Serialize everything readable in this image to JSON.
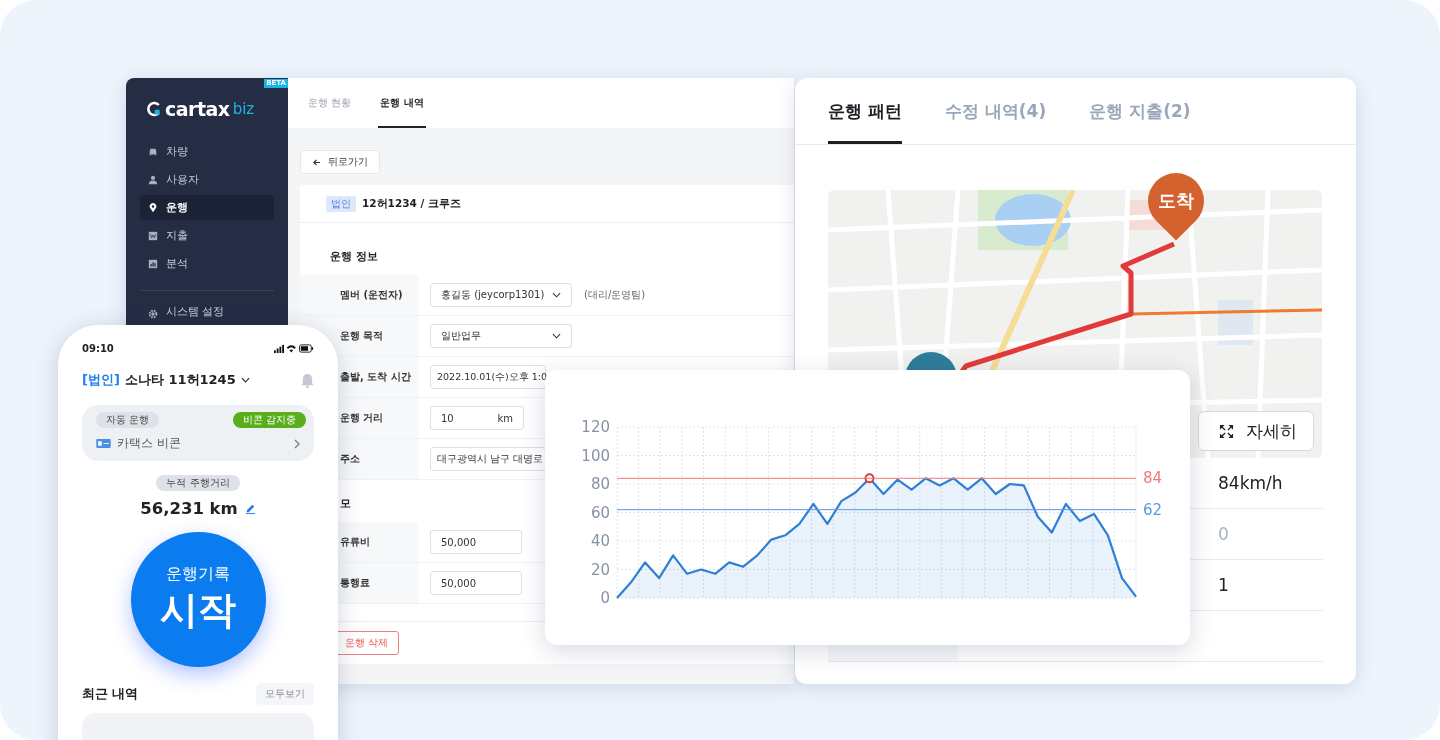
{
  "web_app": {
    "logo": {
      "brand": "cartax",
      "suffix": "biz",
      "badge": "BETA"
    },
    "sidebar": {
      "items": [
        {
          "label": "차량",
          "selected": false
        },
        {
          "label": "사용자",
          "selected": false
        },
        {
          "label": "운행",
          "selected": true
        },
        {
          "label": "지출",
          "selected": false
        },
        {
          "label": "분석",
          "selected": false
        }
      ],
      "settings": "시스템 설정"
    },
    "tabs": [
      {
        "label": "운행 현황",
        "selected": false
      },
      {
        "label": "운행 내역",
        "selected": true
      }
    ],
    "back_button": "뒤로가기",
    "vehicle": {
      "tag": "법인",
      "name": "12허1234 / 크루즈"
    },
    "trip_section": {
      "title": "운행 정보",
      "rows": [
        {
          "label": "멤버 (운전자)",
          "kind": "select",
          "value": "홍길동 (jeycorp1301)",
          "note": "(대리/운영팀)"
        },
        {
          "label": "운행 목적",
          "kind": "select",
          "value": "일반업무"
        },
        {
          "label": "출발, 도착 시간",
          "kind": "input",
          "value": "2022.10.01(수)오후 1:0"
        },
        {
          "label": "운행 거리",
          "kind": "unit",
          "value": "10",
          "unit": "km"
        },
        {
          "label": "주소",
          "kind": "input",
          "value": "대구광역시 남구 대명로"
        }
      ]
    },
    "memo_section": {
      "title": "모",
      "rows": [
        {
          "label": "유류비",
          "value": "50,000"
        },
        {
          "label": "통행료",
          "value": "50,000"
        }
      ]
    },
    "delete_button": "운행 삭제"
  },
  "detail_panel": {
    "tabs": [
      {
        "label": "운행 패턴",
        "selected": true
      },
      {
        "label": "수정 내역(4)",
        "selected": false
      },
      {
        "label": "운행 지출(2)",
        "selected": false
      }
    ],
    "map": {
      "kind": "picture",
      "arrival_pin": "도착",
      "detail_button": "자세히"
    },
    "stats": [
      {
        "value": "84km/h",
        "muted": false
      },
      {
        "value": "0",
        "muted": true
      },
      {
        "value": "1",
        "muted": false
      }
    ]
  },
  "speed_chart": {
    "chart_data": {
      "type": "area",
      "ylim": [
        0,
        120
      ],
      "yticks": [
        0,
        20,
        40,
        60,
        80,
        100,
        120
      ],
      "categories": [
        null,
        null,
        null,
        null,
        null,
        null,
        null,
        null,
        null,
        null,
        null,
        null,
        null,
        null,
        null,
        null,
        null,
        null,
        null,
        null,
        null,
        null,
        null,
        null,
        null,
        null,
        null,
        null,
        null,
        null,
        null,
        null,
        null,
        null,
        null,
        null,
        null,
        null
      ],
      "series": [
        {
          "color": "#2f7fd4",
          "values": [
            0,
            11,
            25,
            14,
            30,
            17,
            20,
            17,
            25,
            22,
            30,
            41,
            44,
            52,
            66,
            52,
            68,
            74,
            84,
            73,
            83,
            76,
            84,
            79,
            84,
            76,
            84,
            73,
            80,
            79,
            57,
            46,
            66,
            54,
            59,
            44,
            14,
            1
          ]
        }
      ],
      "grid": true,
      "ref_lines": [
        {
          "axis": "y",
          "value": 84,
          "label": "84",
          "color": "#f07a7a"
        },
        {
          "axis": "y",
          "value": 62,
          "label": "62",
          "color": "#5b9be0"
        }
      ]
    }
  },
  "phone": {
    "time": "09:10",
    "vehicle_tag": "[법인]",
    "vehicle": "소나타 11허1245",
    "auto_card": {
      "label": "자동 운행",
      "status": "비콘 감지중",
      "device": "카택스 비콘"
    },
    "odometer": {
      "label": "누적 주행거리",
      "value": "56,231 km"
    },
    "start_button": {
      "line1": "운행기록",
      "line2": "시작"
    },
    "recent": {
      "title": "최근 내역",
      "more": "모두보기"
    }
  }
}
